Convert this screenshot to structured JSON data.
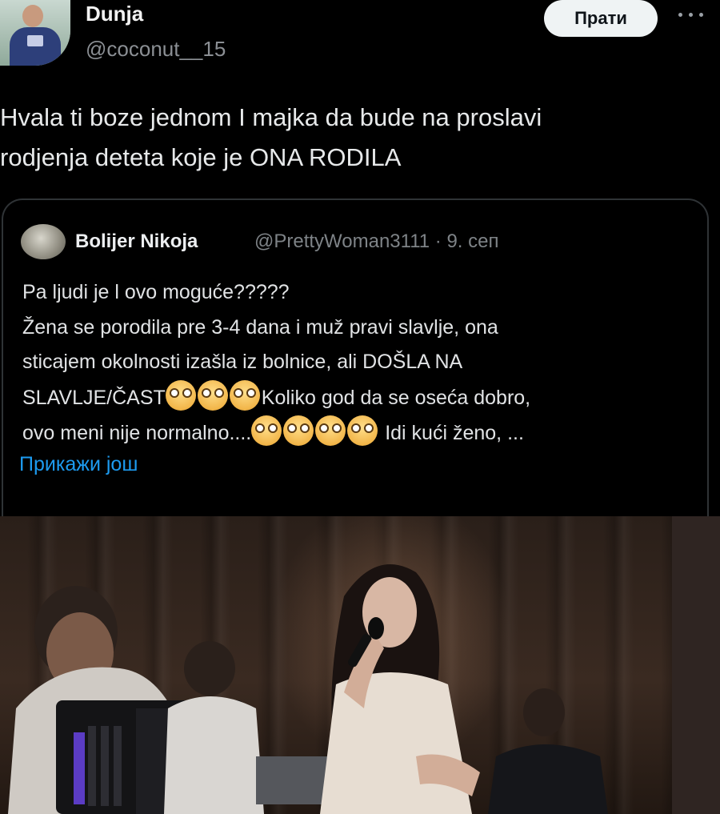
{
  "author": {
    "name": "Dunja",
    "handle": "@coconut__15",
    "follow_label": "Прати",
    "more_icon": "more-horizontal-icon"
  },
  "tweet": {
    "line1": "Hvala ti boze jednom I majka da bude na proslavi",
    "line2": "rodjenja deteta koje je ONA RODILA"
  },
  "quote": {
    "name": "Bolijer Nikoja",
    "handle_time": "@PrettyWoman3111 · 9. сеп",
    "lines": {
      "l1": "Pa ljudi je l ovo moguće?????",
      "l2": "Žena se porodila pre 3-4 dana i muž pravi slavlje, ona",
      "l3": "sticajem okolnosti izašla iz bolnice, ali DOŠLA NA",
      "l4a": "SLAVLJE/ČAST",
      "l4b": "Koliko god da se oseća dobro,",
      "l5a": "ovo meni nije normalno....",
      "l5b": " Idi kući ženo, ..."
    },
    "emoji_icon": "flushed-face-emoji",
    "show_more": "Прикажи још"
  },
  "colors": {
    "background": "#000000",
    "link": "#1d9bf0",
    "border": "#2f3336",
    "secondary_text": "#8b8f94"
  }
}
